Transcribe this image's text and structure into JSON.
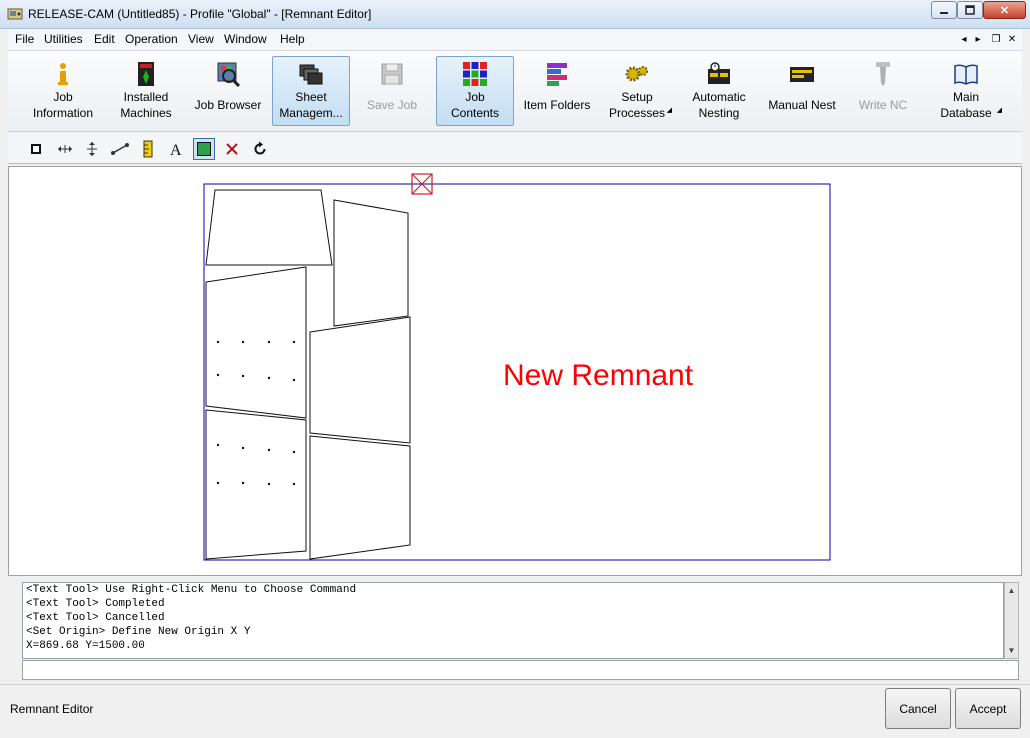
{
  "window": {
    "title": "RELEASE-CAM (Untitled85) - Profile \"Global\" - [Remnant Editor]",
    "controls": {
      "minimize": "0",
      "maximize": "1",
      "close": "✕"
    }
  },
  "menu": {
    "items": [
      "File",
      "Utilities",
      "Edit",
      "Operation",
      "View",
      "Window",
      "Help"
    ],
    "mdi_controls": [
      "◂",
      "▸",
      "❐",
      "✕"
    ]
  },
  "toolbar": {
    "buttons": [
      {
        "label": "Job\nInformation",
        "icon": "info-icon",
        "state": "normal"
      },
      {
        "label": "Installed\nMachines",
        "icon": "machine-icon",
        "state": "normal"
      },
      {
        "label": "Job Browser",
        "icon": "browser-icon",
        "state": "normal"
      },
      {
        "label": "Sheet\nManagem...",
        "icon": "sheets-icon",
        "state": "active"
      },
      {
        "label": "Save Job",
        "icon": "save-disk-icon",
        "state": "disabled"
      },
      {
        "label": "Job\nContents",
        "icon": "grid-icon",
        "state": "active"
      },
      {
        "label": "Item Folders",
        "icon": "folders-icon",
        "state": "normal"
      },
      {
        "label": "Setup\nProcesses",
        "icon": "gears-icon",
        "state": "normal",
        "dropdown": true
      },
      {
        "label": "Automatic\nNesting",
        "icon": "auto-nest-icon",
        "state": "normal"
      },
      {
        "label": "Manual Nest",
        "icon": "manual-nest-icon",
        "state": "normal"
      },
      {
        "label": "Write NC",
        "icon": "drill-bit-icon",
        "state": "disabled"
      },
      {
        "label": "Main\nDatabase",
        "icon": "book-icon",
        "state": "normal",
        "dropdown": true
      }
    ]
  },
  "drawing": {
    "remnant_label": "New Remnant",
    "colors": {
      "sheet": "#0000aa",
      "label": "#ff0000",
      "parts": "#000000",
      "origin_marker": "#cc2222"
    }
  },
  "console": {
    "lines": [
      "<Text Tool> Use Right-Click Menu to Choose Command",
      "<Text Tool> Completed",
      "<Text Tool> Cancelled",
      "<Set Origin> Define New Origin X Y",
      "X=869.68 Y=1500.00"
    ],
    "input_value": ""
  },
  "status": {
    "text": "Remnant Editor",
    "cancel_label": "Cancel",
    "accept_label": "Accept"
  }
}
